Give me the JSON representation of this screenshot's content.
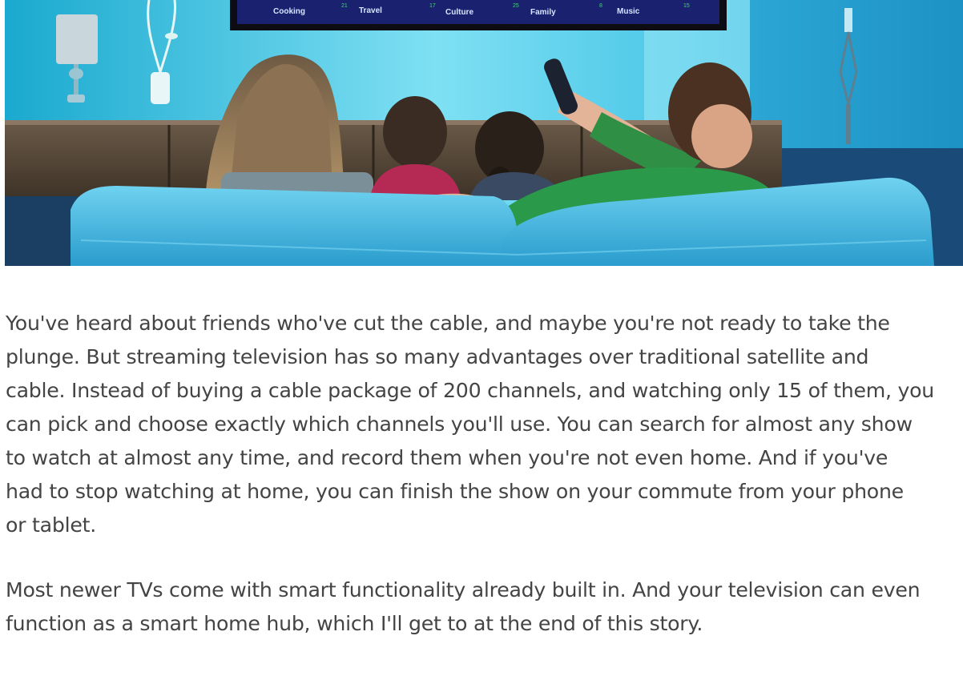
{
  "hero": {
    "tv_menu": [
      {
        "label": "Cooking",
        "num": "21"
      },
      {
        "label": "Travel",
        "num": "17"
      },
      {
        "label": "Culture",
        "num": "25"
      },
      {
        "label": "Family",
        "num": "8"
      },
      {
        "label": "Music",
        "num": "15"
      }
    ]
  },
  "article": {
    "paragraphs": [
      {
        "lines": [
          "You've heard about friends who've cut the cable, and maybe you're not ready to take the",
          "plunge. But streaming television has so many advantages over traditional satellite and",
          "cable. Instead of buying a cable package of 200 channels, and watching only 15 of them, you",
          "can pick and choose exactly which channels you'll use. You can search for almost any show",
          "to watch at almost any time, and record them when you're not even home. And if you've",
          "had to stop watching at home, you can finish the show on your commute from your phone",
          "or tablet."
        ]
      },
      {
        "lines": [
          "Most newer TVs come with smart functionality already built in. And your television can even",
          "function as a smart home hub, which I'll get to at the end of this story."
        ]
      }
    ]
  }
}
